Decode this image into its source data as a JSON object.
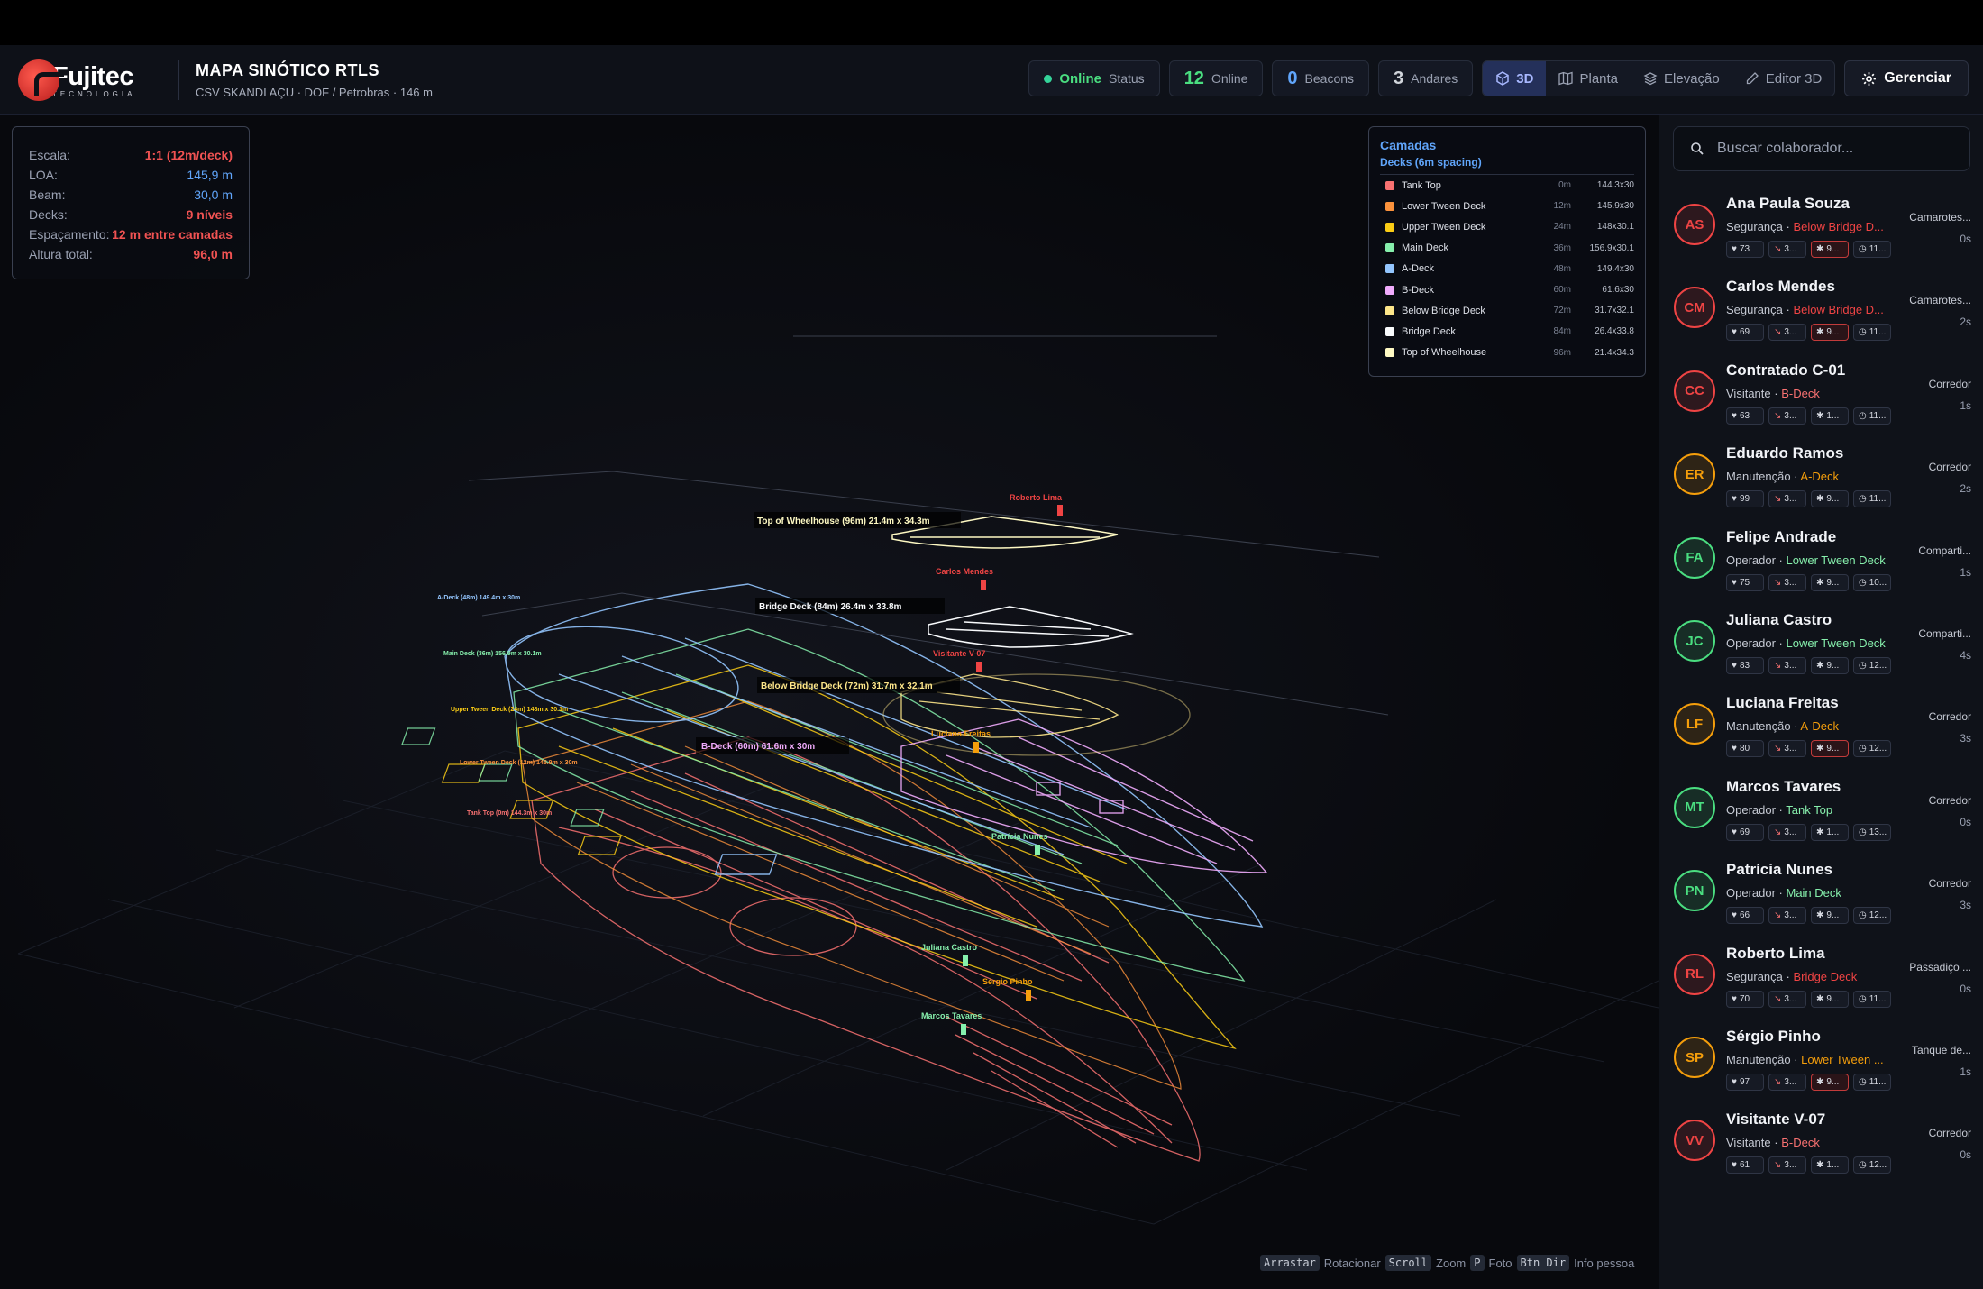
{
  "app": {
    "brand": "Fujitec",
    "brand_sub": "TECNOLOGIA",
    "title": "MAPA SINÓTICO RTLS",
    "subtitle": "CSV SKANDI AÇU · DOF / Petrobras · 146 m"
  },
  "stats": {
    "status_value": "Online",
    "status_label": "Status",
    "online_value": "12",
    "online_label": "Online",
    "beacons_value": "0",
    "beacons_label": "Beacons",
    "floors_value": "3",
    "floors_label": "Andares"
  },
  "views": {
    "v3d": "3D",
    "plan": "Planta",
    "elevation": "Elevação",
    "editor": "Editor 3D"
  },
  "manage_label": "Gerenciar",
  "info": [
    {
      "k": "Escala:",
      "v": "1:1 (12m/deck)",
      "color": "#f05252"
    },
    {
      "k": "LOA:",
      "v": "145,9 m",
      "color": "#60a5fa"
    },
    {
      "k": "Beam:",
      "v": "30,0 m",
      "color": "#60a5fa"
    },
    {
      "k": "Decks:",
      "v": "9 níveis",
      "color": "#f05252"
    },
    {
      "k": "Espaçamento:",
      "v": "12 m entre camadas",
      "color": "#f05252"
    },
    {
      "k": "Altura total:",
      "v": "96,0 m",
      "color": "#f05252"
    }
  ],
  "layers": {
    "title": "Camadas",
    "subtitle": "Decks (6m spacing)",
    "items": [
      {
        "name": "Tank Top",
        "elev": "0m",
        "dims": "144.3x30",
        "color": "#f87171"
      },
      {
        "name": "Lower Tween Deck",
        "elev": "12m",
        "dims": "145.9x30",
        "color": "#fb923c"
      },
      {
        "name": "Upper Tween Deck",
        "elev": "24m",
        "dims": "148x30.1",
        "color": "#facc15"
      },
      {
        "name": "Main Deck",
        "elev": "36m",
        "dims": "156.9x30.1",
        "color": "#86efac"
      },
      {
        "name": "A-Deck",
        "elev": "48m",
        "dims": "149.4x30",
        "color": "#93c5fd"
      },
      {
        "name": "B-Deck",
        "elev": "60m",
        "dims": "61.6x30",
        "color": "#f0abfc"
      },
      {
        "name": "Below Bridge Deck",
        "elev": "72m",
        "dims": "31.7x32.1",
        "color": "#fde68a"
      },
      {
        "name": "Bridge Deck",
        "elev": "84m",
        "dims": "26.4x33.8",
        "color": "#f8fafc"
      },
      {
        "name": "Top of Wheelhouse",
        "elev": "96m",
        "dims": "21.4x34.3",
        "color": "#fef9c3"
      }
    ]
  },
  "deck_labels": {
    "wheelhouse": "Top of Wheelhouse (96m) 21.4m x 34.3m",
    "bridge": "Bridge Deck (84m) 26.4m x 33.8m",
    "below_bridge": "Below Bridge Deck (72m) 31.7m x 32.1m",
    "b_deck": "B-Deck (60m) 61.6m x 30m",
    "a_deck": "A-Deck (48m) 149.4m x 30m",
    "main": "Main Deck (36m) 156.9m x 30.1m",
    "upper": "Upper Tween Deck (24m) 148m x 30.1m",
    "lower": "Lower Tween Deck (12m) 145.9m x 30m",
    "tank": "Tank Top (0m) 144.3m x 30m"
  },
  "map_markers": [
    {
      "name": "Roberto Lima",
      "color": "#ef4444"
    },
    {
      "name": "Carlos Mendes",
      "color": "#ef4444"
    },
    {
      "name": "Visitante V-07",
      "color": "#ef4444"
    },
    {
      "name": "Luciana Freitas",
      "color": "#f59e0b"
    },
    {
      "name": "Patrícia Nunes",
      "color": "#86efac"
    },
    {
      "name": "Juliana Castro",
      "color": "#86efac"
    },
    {
      "name": "Sérgio Pinho",
      "color": "#f59e0b"
    },
    {
      "name": "Marcos Tavares",
      "color": "#86efac"
    }
  ],
  "help": {
    "k1": "Arrastar",
    "t1": "Rotacionar",
    "k2": "Scroll",
    "t2": "Zoom",
    "k3": "P",
    "t3": "Foto",
    "k4": "Btn Dir",
    "t4": "Info pessoa"
  },
  "search_placeholder": "Buscar colaborador...",
  "people": [
    {
      "initials": "AS",
      "name": "Ana Paula Souza",
      "role": "Segurança",
      "deck": "Below Bridge D...",
      "deck_color": "#ef4444",
      "color": "#ef4444",
      "location": "Camarotes...",
      "time": "0s",
      "hr": "73",
      "c2": "3...",
      "c3": "9...",
      "c4": "11...",
      "alert": true
    },
    {
      "initials": "CM",
      "name": "Carlos Mendes",
      "role": "Segurança",
      "deck": "Below Bridge D...",
      "deck_color": "#ef4444",
      "color": "#ef4444",
      "location": "Camarotes...",
      "time": "2s",
      "hr": "69",
      "c2": "3...",
      "c3": "9...",
      "c4": "11...",
      "alert": true
    },
    {
      "initials": "CC",
      "name": "Contratado C-01",
      "role": "Visitante",
      "deck": "B-Deck",
      "deck_color": "#f87171",
      "color": "#ef4444",
      "location": "Corredor",
      "time": "1s",
      "hr": "63",
      "c2": "3...",
      "c3": "1...",
      "c4": "11...",
      "alert": false
    },
    {
      "initials": "ER",
      "name": "Eduardo Ramos",
      "role": "Manutenção",
      "deck": "A-Deck",
      "deck_color": "#f59e0b",
      "color": "#f59e0b",
      "location": "Corredor",
      "time": "2s",
      "hr": "99",
      "c2": "3...",
      "c3": "9...",
      "c4": "11...",
      "alert": false
    },
    {
      "initials": "FA",
      "name": "Felipe Andrade",
      "role": "Operador",
      "deck": "Lower Tween Deck",
      "deck_color": "#86efac",
      "color": "#4ade80",
      "location": "Comparti...",
      "time": "1s",
      "hr": "75",
      "c2": "3...",
      "c3": "9...",
      "c4": "10...",
      "alert": false
    },
    {
      "initials": "JC",
      "name": "Juliana Castro",
      "role": "Operador",
      "deck": "Lower Tween Deck",
      "deck_color": "#86efac",
      "color": "#4ade80",
      "location": "Comparti...",
      "time": "4s",
      "hr": "83",
      "c2": "3...",
      "c3": "9...",
      "c4": "12...",
      "alert": false
    },
    {
      "initials": "LF",
      "name": "Luciana Freitas",
      "role": "Manutenção",
      "deck": "A-Deck",
      "deck_color": "#f59e0b",
      "color": "#f59e0b",
      "location": "Corredor",
      "time": "3s",
      "hr": "80",
      "c2": "3...",
      "c3": "9...",
      "c4": "12...",
      "alert": true
    },
    {
      "initials": "MT",
      "name": "Marcos Tavares",
      "role": "Operador",
      "deck": "Tank Top",
      "deck_color": "#86efac",
      "color": "#4ade80",
      "location": "Corredor",
      "time": "0s",
      "hr": "69",
      "c2": "3...",
      "c3": "1...",
      "c4": "13...",
      "alert": false
    },
    {
      "initials": "PN",
      "name": "Patrícia Nunes",
      "role": "Operador",
      "deck": "Main Deck",
      "deck_color": "#86efac",
      "color": "#4ade80",
      "location": "Corredor",
      "time": "3s",
      "hr": "66",
      "c2": "3...",
      "c3": "9...",
      "c4": "12...",
      "alert": false
    },
    {
      "initials": "RL",
      "name": "Roberto Lima",
      "role": "Segurança",
      "deck": "Bridge Deck",
      "deck_color": "#ef4444",
      "color": "#ef4444",
      "location": "Passadiço ...",
      "time": "0s",
      "hr": "70",
      "c2": "3...",
      "c3": "9...",
      "c4": "11...",
      "alert": false
    },
    {
      "initials": "SP",
      "name": "Sérgio Pinho",
      "role": "Manutenção",
      "deck": "Lower Tween ...",
      "deck_color": "#f59e0b",
      "color": "#f59e0b",
      "location": "Tanque de...",
      "time": "1s",
      "hr": "97",
      "c2": "3...",
      "c3": "9...",
      "c4": "11...",
      "alert": true
    },
    {
      "initials": "VV",
      "name": "Visitante V-07",
      "role": "Visitante",
      "deck": "B-Deck",
      "deck_color": "#f87171",
      "color": "#ef4444",
      "location": "Corredor",
      "time": "0s",
      "hr": "61",
      "c2": "3...",
      "c3": "1...",
      "c4": "12...",
      "alert": false
    }
  ]
}
